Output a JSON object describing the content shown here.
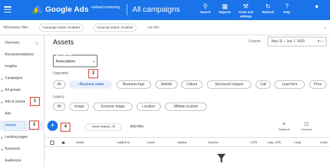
{
  "topbar": {
    "brand": "Google Ads",
    "account": "wellweb.marketing",
    "page_title": "All campaigns",
    "icons": [
      {
        "name": "search-icon",
        "label": "Search"
      },
      {
        "name": "reports-icon",
        "label": "Reports"
      },
      {
        "name": "tools-icon",
        "label": "Tools and settings"
      },
      {
        "name": "refresh-icon",
        "label": "Refresh"
      },
      {
        "name": "help-icon",
        "label": "Help"
      }
    ]
  },
  "filterbar": {
    "workspace_filter": "Workspace filter",
    "campaign_status": "Campaign status: Enabled",
    "ad_group_status": "Ad group status: Enabled",
    "add_filter": "Add filter"
  },
  "sidebar": {
    "items": [
      {
        "label": "Overview"
      },
      {
        "label": "Recommendations"
      },
      {
        "label": "Insights"
      },
      {
        "label": "Campaigns"
      },
      {
        "label": "Ad groups"
      },
      {
        "label": "Ads & assets"
      },
      {
        "label": "Ads"
      },
      {
        "label": "Assets"
      },
      {
        "label": "Landing pages"
      },
      {
        "label": "Keywords"
      },
      {
        "label": "Audiences"
      }
    ]
  },
  "main": {
    "title": "Assets",
    "date_label": "Custom",
    "date_range": "May 11 – Jun 7, 2023",
    "table_view_label": "Table view",
    "table_view_value": "Associations",
    "upgraded_label": "Upgraded",
    "upgraded_chips": [
      "All",
      "Business name",
      "Business logo",
      "Sitelink",
      "Callout",
      "Structured snippet",
      "Call",
      "Lead form",
      "Price"
    ],
    "legacy_label": "Legacy",
    "legacy_chips": [
      "All",
      "Image",
      "Dynamic image",
      "Location",
      "Affiliate location"
    ],
    "asset_status": "Asset status: All",
    "add_filter": "Add filter",
    "segment": "Segment",
    "columns": "Columns"
  },
  "callouts": [
    "1",
    "2",
    "3",
    "4"
  ],
  "table": {
    "headers": [
      "Asset",
      "Added to",
      "Level",
      "Status",
      "Source",
      "CTR",
      "Avg. CPC",
      "Impr.",
      "Conv"
    ]
  },
  "colors": {
    "brand_blue": "#1a73e8",
    "callout_red": "#d93025",
    "selected_chip": "#e8f0fe"
  }
}
